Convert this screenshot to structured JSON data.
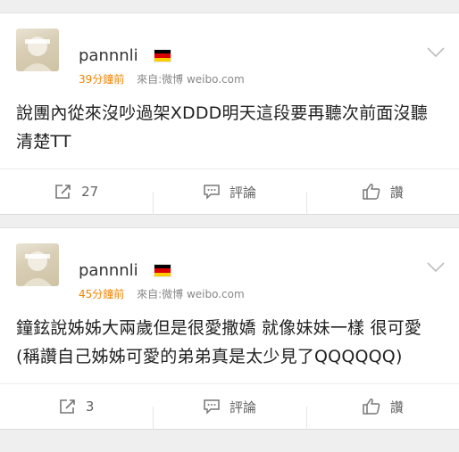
{
  "posts": [
    {
      "username": "pannnli",
      "time": "39分鐘前",
      "source": "來自:微博 weibo.com",
      "text": "說團內從來沒吵過架XDDD明天這段要再聽次前面沒聽清楚TT",
      "repost_count": "27",
      "comment_label": "評論",
      "like_label": "讚"
    },
    {
      "username": "pannnli",
      "time": "45分鐘前",
      "source": "來自:微博 weibo.com",
      "text": "鐘鉉說姊姊大兩歲但是很愛撒嬌 就像妹妹一樣 很可愛 (稱讚自己姊姊可愛的弟弟真是太少見了QQQQQQ)",
      "repost_count": "3",
      "comment_label": "評論",
      "like_label": "讚"
    }
  ],
  "colors": {
    "time": "#f28400",
    "flag_top": "#000000",
    "flag_mid": "#dd0000",
    "flag_bottom": "#ffce00"
  }
}
